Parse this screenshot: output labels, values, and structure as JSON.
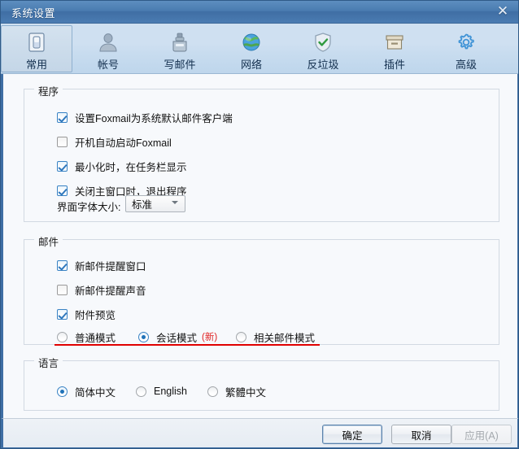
{
  "window": {
    "title": "系统设置",
    "close_label": "✕"
  },
  "toolbar": {
    "tabs": [
      {
        "label": "常用",
        "icon": "general-icon",
        "selected": true
      },
      {
        "label": "帐号",
        "icon": "account-person-icon",
        "selected": false
      },
      {
        "label": "写邮件",
        "icon": "compose-mail-icon",
        "selected": false
      },
      {
        "label": "网络",
        "icon": "network-globe-icon",
        "selected": false
      },
      {
        "label": "反垃圾",
        "icon": "antispam-shield-icon",
        "selected": false
      },
      {
        "label": "插件",
        "icon": "plugin-box-icon",
        "selected": false
      },
      {
        "label": "高级",
        "icon": "advanced-gear-icon",
        "selected": false
      }
    ]
  },
  "program_group": {
    "title": "程序",
    "checkboxes": [
      {
        "label": "设置Foxmail为系统默认邮件客户端",
        "checked": true
      },
      {
        "label": "开机自动启动Foxmail",
        "checked": false
      },
      {
        "label": "最小化时，在任务栏显示",
        "checked": true
      },
      {
        "label": "关闭主窗口时，退出程序",
        "checked": true
      }
    ],
    "font_size_label": "界面字体大小:",
    "font_size_value": "标准"
  },
  "mail_group": {
    "title": "邮件",
    "checkboxes": [
      {
        "label": "新邮件提醒窗口",
        "checked": true
      },
      {
        "label": "新邮件提醒声音",
        "checked": false
      },
      {
        "label": "附件预览",
        "checked": true
      }
    ],
    "mode_radios": [
      {
        "label": "普通模式",
        "selected": false,
        "badge": ""
      },
      {
        "label": "会话模式",
        "selected": true,
        "badge": "(新)"
      },
      {
        "label": "相关邮件模式",
        "selected": false,
        "badge": ""
      }
    ],
    "highlight_color": "#e00000"
  },
  "language_group": {
    "title": "语言",
    "radios": [
      {
        "label": "简体中文",
        "selected": true
      },
      {
        "label": "English",
        "selected": false
      },
      {
        "label": "繁體中文",
        "selected": false
      }
    ]
  },
  "buttons": {
    "ok": "确定",
    "cancel": "取消",
    "apply": "应用(A)",
    "apply_disabled": true
  }
}
